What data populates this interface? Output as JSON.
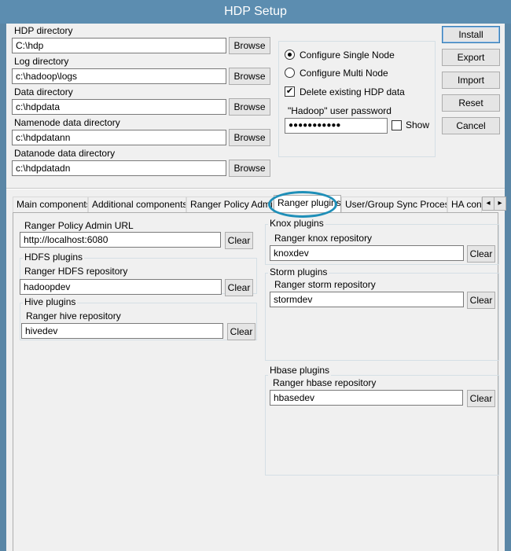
{
  "window": {
    "title": "HDP Setup"
  },
  "paths": {
    "hdp_label": "HDP directory",
    "hdp_value": "C:\\hdp",
    "log_label": "Log directory",
    "log_value": "c:\\hadoop\\logs",
    "data_label": "Data directory",
    "data_value": "c:\\hdpdata",
    "namenode_label": "Namenode data directory",
    "namenode_value": "c:\\hdpdatann",
    "datanode_label": "Datanode data directory",
    "datanode_value": "c:\\hdpdatadn",
    "browse_label": "Browse"
  },
  "options": {
    "single_node": "Configure Single Node",
    "multi_node": "Configure Multi Node",
    "delete_existing": "Delete existing HDP data",
    "password_label": "\"Hadoop\" user password",
    "password_value": "●●●●●●●●●●●",
    "show_label": "Show"
  },
  "actions": {
    "install": "Install",
    "export": "Export",
    "import": "Import",
    "reset": "Reset",
    "cancel": "Cancel"
  },
  "tabs": [
    {
      "label": "Main components"
    },
    {
      "label": "Additional components"
    },
    {
      "label": "Ranger Policy Admin"
    },
    {
      "label": "Ranger plugins"
    },
    {
      "label": "User/Group Sync Process"
    },
    {
      "label": "HA con"
    }
  ],
  "tab_scroll": {
    "left": "◂",
    "right": "▸"
  },
  "ranger": {
    "admin_url_label": "Ranger Policy Admin URL",
    "admin_url_value": "http://localhost:6080",
    "clear_label": "Clear",
    "hdfs_group": "HDFS plugins",
    "hdfs_repo_label": "Ranger HDFS repository",
    "hdfs_repo_value": "hadoopdev",
    "hive_group": "Hive plugins",
    "hive_repo_label": "Ranger hive repository",
    "hive_repo_value": "hivedev",
    "knox_group": "Knox plugins",
    "knox_repo_label": "Ranger knox repository",
    "knox_repo_value": "knoxdev",
    "storm_group": "Storm plugins",
    "storm_repo_label": "Ranger storm repository",
    "storm_repo_value": "stormdev",
    "hbase_group": "Hbase plugins",
    "hbase_repo_label": "Ranger hbase repository",
    "hbase_repo_value": "hbasedev"
  },
  "colors": {
    "titlebar": "#5c8db0",
    "highlight": "#1f8fb8",
    "panel": "#f0f0f0"
  }
}
